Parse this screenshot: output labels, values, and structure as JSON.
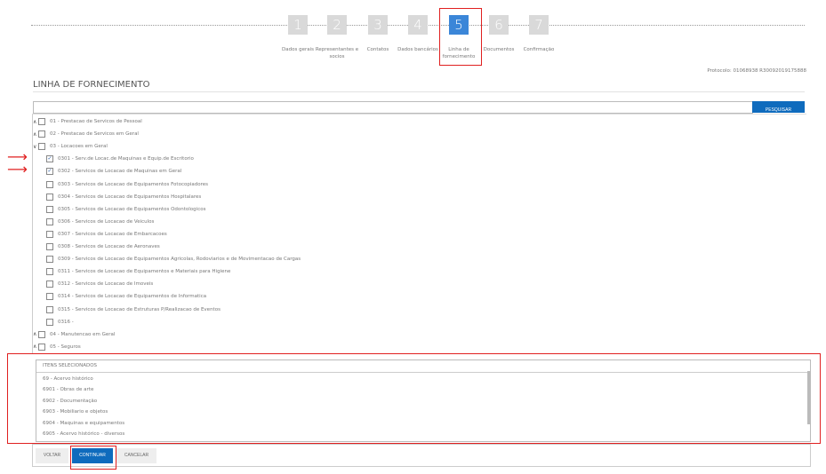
{
  "steps": [
    {
      "n": "1",
      "label": "Dados gerais"
    },
    {
      "n": "2",
      "label": "Representantes e socios"
    },
    {
      "n": "3",
      "label": "Contatos"
    },
    {
      "n": "4",
      "label": "Dados bancários"
    },
    {
      "n": "5",
      "label": "Linha de fornecimento"
    },
    {
      "n": "6",
      "label": "Documentos"
    },
    {
      "n": "7",
      "label": "Confirmação"
    }
  ],
  "active_step": 5,
  "protocol": "Protocolo: 01068938 R30092019175888",
  "title": "LINHA DE FORNECIMENTO",
  "search": {
    "value": "",
    "button": "PESQUISAR"
  },
  "tree": [
    {
      "toggle": "^",
      "checked": false,
      "level": 0,
      "label": "01 - Prestacao de Servicos de Pessoal"
    },
    {
      "toggle": "^",
      "checked": false,
      "level": 0,
      "label": "02 - Prestacao de Servicos em Geral"
    },
    {
      "toggle": "v",
      "checked": false,
      "level": 0,
      "label": "03 - Locacoes em Geral"
    },
    {
      "checked": true,
      "level": 1,
      "label": "0301 - Serv.de Locac.de Maquinas e Equip.de Escritorio"
    },
    {
      "checked": true,
      "level": 1,
      "label": "0302 - Servicos de Locacao de Maquinas em Geral"
    },
    {
      "checked": false,
      "level": 1,
      "label": "0303 - Servicos de Locacao de Equipamentos Fotocopiadores"
    },
    {
      "checked": false,
      "level": 1,
      "label": "0304 - Servicos de Locacao de Equipamentos Hospitalares"
    },
    {
      "checked": false,
      "level": 1,
      "label": "0305 - Servicos de Locacao de Equipamentos Odontologicos"
    },
    {
      "checked": false,
      "level": 1,
      "label": "0306 - Servicos de Locacao de Veiculos"
    },
    {
      "checked": false,
      "level": 1,
      "label": "0307 - Servicos de Locacao de Embarcacoes"
    },
    {
      "checked": false,
      "level": 1,
      "label": "0308 - Servicos de Locacao de Aeronaves"
    },
    {
      "checked": false,
      "level": 1,
      "label": "0309 - Servicos de Locacao de Equipamentos Agricolas, Rodoviarios e de Movimentacao de Cargas"
    },
    {
      "checked": false,
      "level": 1,
      "label": "0311 - Servicos de Locacao de Equipamentos e Materiais para Higiene"
    },
    {
      "checked": false,
      "level": 1,
      "label": "0312 - Servicos de Locacao de Imoveis"
    },
    {
      "checked": false,
      "level": 1,
      "label": "0314 - Servicos de Locacao de Equipamentos de Informatica"
    },
    {
      "checked": false,
      "level": 1,
      "label": "0315 - Servicos de Locacao de Estruturas P/Realizacao de Eventos"
    },
    {
      "checked": false,
      "level": 1,
      "label": "0316 -"
    },
    {
      "toggle": "^",
      "checked": false,
      "level": 0,
      "label": "04 - Manutencao em Geral"
    },
    {
      "toggle": "^",
      "checked": false,
      "level": 0,
      "label": "05 - Seguros"
    }
  ],
  "selected": {
    "header": "ITENS SELECIONADOS",
    "items": [
      "69 - Acervo histórico",
      "6901 - Obras de arte",
      "6902 - Documentação",
      "6903 - Mobiliario e objetos",
      "6904 - Maquinas e equipamentos",
      "6905 - Acervo histórico - diversos"
    ]
  },
  "buttons": {
    "back": "VOLTAR",
    "continue": "CONTINUAR",
    "cancel": "CANCELAR"
  }
}
